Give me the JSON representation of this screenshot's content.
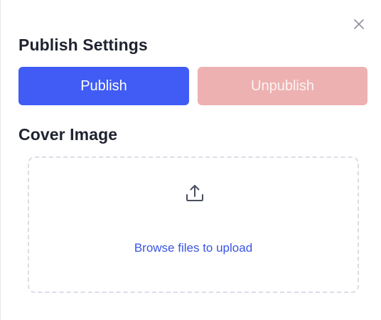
{
  "publish_settings": {
    "title": "Publish Settings",
    "publish_label": "Publish",
    "unpublish_label": "Unpublish"
  },
  "cover_image": {
    "title": "Cover Image",
    "browse_label": "Browse files to upload",
    "icon": "upload-icon"
  },
  "close": {
    "icon": "close-icon"
  },
  "colors": {
    "primary": "#405cf5",
    "danger_disabled": "#edb1b1",
    "link": "#3a55e2",
    "dropzone_border": "#dcdde6"
  }
}
